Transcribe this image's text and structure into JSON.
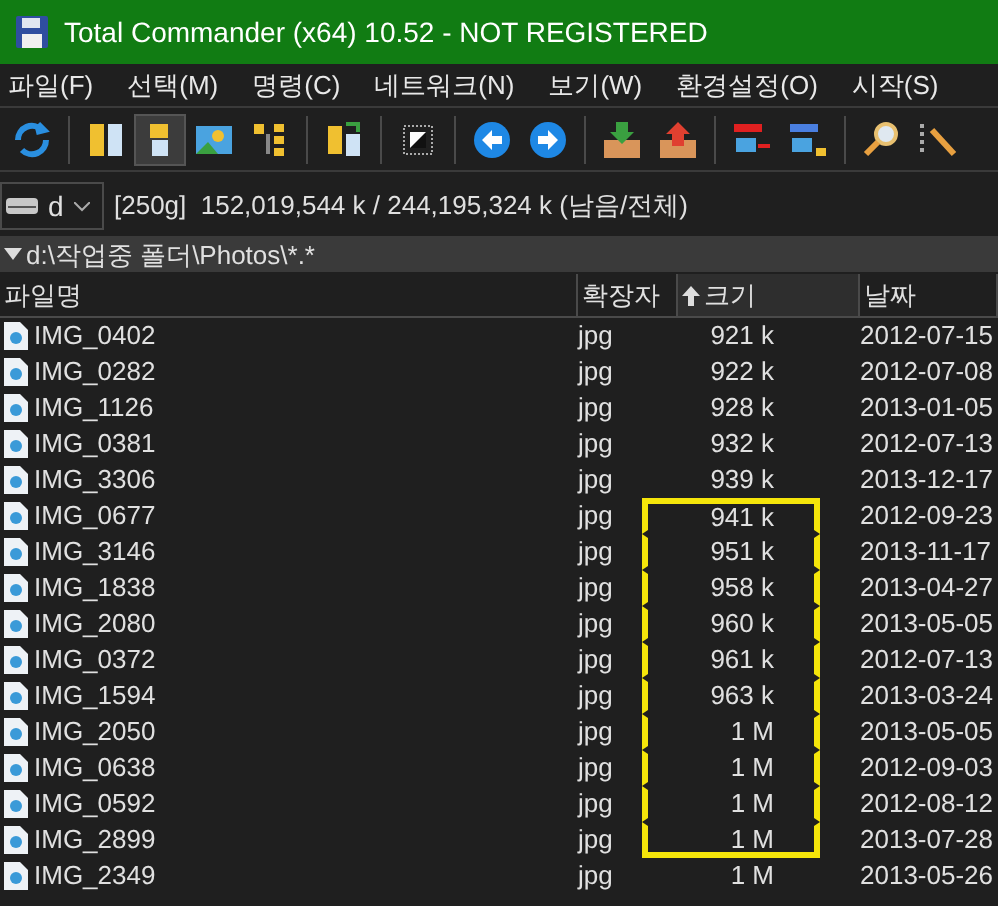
{
  "window": {
    "title": "Total Commander (x64) 10.52 - NOT REGISTERED"
  },
  "menu": [
    "파일(F)",
    "선택(M)",
    "명령(C)",
    "네트워크(N)",
    "보기(W)",
    "환경설정(O)",
    "시작(S)"
  ],
  "toolbar": [
    {
      "kind": "refresh",
      "selected": false
    },
    {
      "kind": "sep"
    },
    {
      "kind": "brief",
      "selected": false
    },
    {
      "kind": "full",
      "selected": true
    },
    {
      "kind": "thumbs",
      "selected": false
    },
    {
      "kind": "tree",
      "selected": false
    },
    {
      "kind": "sep"
    },
    {
      "kind": "sync",
      "selected": false
    },
    {
      "kind": "sep"
    },
    {
      "kind": "invert",
      "selected": false
    },
    {
      "kind": "sep"
    },
    {
      "kind": "back",
      "selected": false
    },
    {
      "kind": "forward",
      "selected": false
    },
    {
      "kind": "sep"
    },
    {
      "kind": "pack",
      "selected": false
    },
    {
      "kind": "unpack",
      "selected": false
    },
    {
      "kind": "sep"
    },
    {
      "kind": "ftp",
      "selected": false
    },
    {
      "kind": "url",
      "selected": false
    },
    {
      "kind": "sep"
    },
    {
      "kind": "search",
      "selected": false
    },
    {
      "kind": "rename",
      "selected": false
    }
  ],
  "drive": {
    "letter": "d",
    "info": "[250g]  152,019,544 k / 244,195,324 k (남음/전체)"
  },
  "path": "d:\\작업중 폴더\\Photos\\*.*",
  "columns": [
    {
      "label": "파일명",
      "sorted": false
    },
    {
      "label": "확장자",
      "sorted": false
    },
    {
      "label": "크기",
      "sorted": true
    },
    {
      "label": "날짜",
      "sorted": false
    }
  ],
  "rows": [
    {
      "name": "IMG_0402",
      "ext": "jpg",
      "size": "921 k",
      "date": "2012-07-15",
      "marked": false
    },
    {
      "name": "IMG_0282",
      "ext": "jpg",
      "size": "922 k",
      "date": "2012-07-08",
      "marked": false
    },
    {
      "name": "IMG_1126",
      "ext": "jpg",
      "size": "928 k",
      "date": "2013-01-05",
      "marked": false
    },
    {
      "name": "IMG_0381",
      "ext": "jpg",
      "size": "932 k",
      "date": "2012-07-13",
      "marked": false
    },
    {
      "name": "IMG_3306",
      "ext": "jpg",
      "size": "939 k",
      "date": "2013-12-17",
      "marked": false
    },
    {
      "name": "IMG_0677",
      "ext": "jpg",
      "size": "941 k",
      "date": "2012-09-23",
      "marked": true
    },
    {
      "name": "IMG_3146",
      "ext": "jpg",
      "size": "951 k",
      "date": "2013-11-17",
      "marked": true
    },
    {
      "name": "IMG_1838",
      "ext": "jpg",
      "size": "958 k",
      "date": "2013-04-27",
      "marked": true
    },
    {
      "name": "IMG_2080",
      "ext": "jpg",
      "size": "960 k",
      "date": "2013-05-05",
      "marked": true
    },
    {
      "name": "IMG_0372",
      "ext": "jpg",
      "size": "961 k",
      "date": "2012-07-13",
      "marked": true
    },
    {
      "name": "IMG_1594",
      "ext": "jpg",
      "size": "963 k",
      "date": "2013-03-24",
      "marked": true
    },
    {
      "name": "IMG_2050",
      "ext": "jpg",
      "size": "1 M",
      "date": "2013-05-05",
      "marked": true
    },
    {
      "name": "IMG_0638",
      "ext": "jpg",
      "size": "1 M",
      "date": "2012-09-03",
      "marked": true
    },
    {
      "name": "IMG_0592",
      "ext": "jpg",
      "size": "1 M",
      "date": "2012-08-12",
      "marked": true
    },
    {
      "name": "IMG_2899",
      "ext": "jpg",
      "size": "1 M",
      "date": "2013-07-28",
      "marked": true
    },
    {
      "name": "IMG_2349",
      "ext": "jpg",
      "size": "1 M",
      "date": "2013-05-26",
      "marked": false
    }
  ]
}
